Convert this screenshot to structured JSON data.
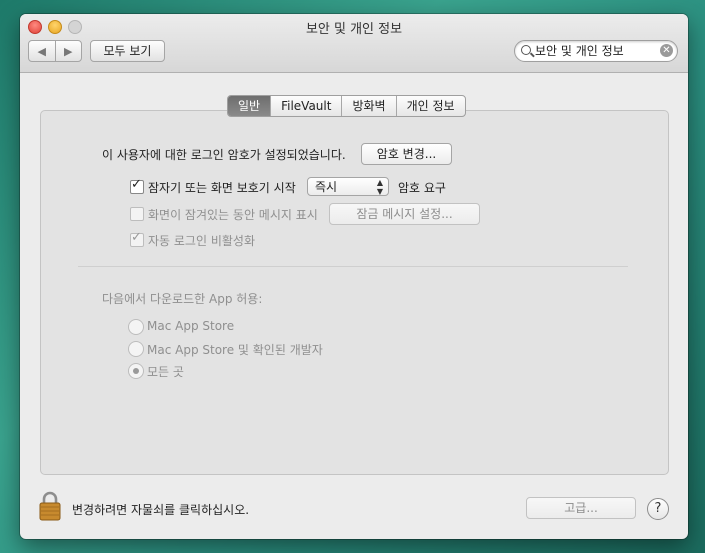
{
  "window": {
    "title": "보안 및 개인 정보",
    "show_all_label": "모두 보기",
    "search_value": "보안 및 개인 정보"
  },
  "tabs": [
    {
      "label": "일반",
      "active": true
    },
    {
      "label": "FileVault",
      "active": false
    },
    {
      "label": "방화벽",
      "active": false
    },
    {
      "label": "개인 정보",
      "active": false
    }
  ],
  "general": {
    "login_password_text": "이 사용자에 대한 로그인 암호가 설정되었습니다.",
    "change_password_button": "암호 변경...",
    "require_password_label": "잠자기 또는 화면 보호기 시작",
    "require_password_checked": true,
    "require_password_delay": "즉시",
    "require_password_suffix": "암호 요구",
    "show_message_label": "화면이 잠겨있는 동안 메시지 표시",
    "show_message_checked": false,
    "set_lock_message_button": "잠금 메시지 설정...",
    "disable_auto_login_label": "자동 로그인 비활성화",
    "disable_auto_login_checked": true
  },
  "downloads": {
    "heading": "다음에서 다운로드한 App 허용:",
    "options": [
      {
        "label": "Mac App Store",
        "selected": false
      },
      {
        "label": "Mac App Store 및 확인된 개발자",
        "selected": false
      },
      {
        "label": "모든 곳",
        "selected": true
      }
    ]
  },
  "footer": {
    "lock_text": "변경하려면 자물쇠를 클릭하십시오.",
    "advanced_button": "고급...",
    "help_label": "?"
  }
}
